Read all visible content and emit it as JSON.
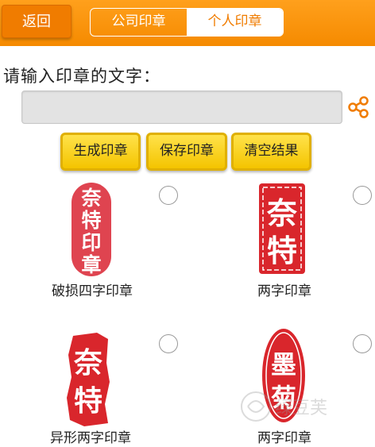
{
  "header": {
    "back_label": "返回",
    "tabs": [
      {
        "label": "公司印章",
        "active": false
      },
      {
        "label": "个人印章",
        "active": true
      }
    ]
  },
  "form": {
    "prompt": "请输入印章的文字：",
    "input_value": "",
    "input_placeholder": ""
  },
  "actions": {
    "generate": "生成印章",
    "save": "保存印章",
    "clear": "清空结果"
  },
  "seals": [
    {
      "label": "破损四字印章",
      "chars": [
        "奈",
        "特",
        "印",
        "章"
      ],
      "selected": false
    },
    {
      "label": "两字印章",
      "chars": [
        "奈",
        "特"
      ],
      "selected": false
    },
    {
      "label": "异形两字印章",
      "chars": [
        "奈",
        "特"
      ],
      "selected": false
    },
    {
      "label": "两字印章",
      "chars": [
        "墨",
        "菊"
      ],
      "selected": false
    }
  ],
  "watermark_text": "绿豆芙",
  "colors": {
    "header_orange": "#f58a00",
    "seal_red": "#d9262c",
    "seal_pink_red": "#df4450",
    "button_yellow": "#f4c400"
  }
}
